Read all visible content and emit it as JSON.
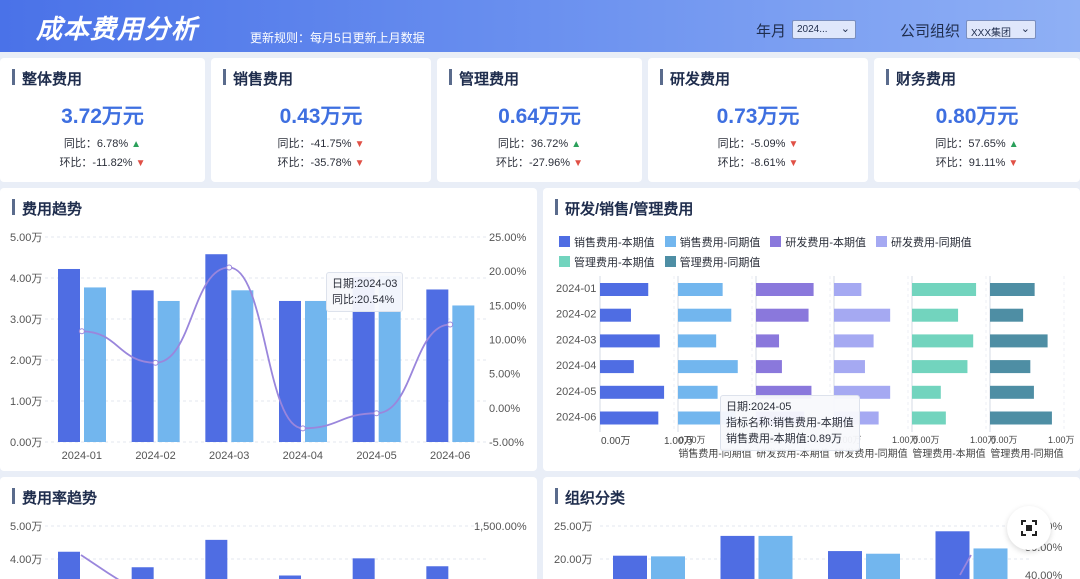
{
  "header": {
    "title": "成本费用分析",
    "rule": "更新规则：每月5日更新上月数据",
    "filter_year_label": "年月",
    "filter_year_value": "2024...",
    "filter_org_label": "公司组织",
    "filter_org_value": "XXX集团",
    "chevron_icon": "chevron-down-icon"
  },
  "kpis": [
    {
      "title": "整体费用",
      "value": "3.72万元",
      "yoy": "同比：6.78%",
      "yoy_dir": "up",
      "mom": "环比：-11.82%",
      "mom_dir": "down"
    },
    {
      "title": "销售费用",
      "value": "0.43万元",
      "yoy": "同比：-41.75%",
      "yoy_dir": "down",
      "mom": "环比：-35.78%",
      "mom_dir": "down"
    },
    {
      "title": "管理费用",
      "value": "0.64万元",
      "yoy": "同比：36.72%",
      "yoy_dir": "up",
      "mom": "环比：-27.96%",
      "mom_dir": "down"
    },
    {
      "title": "研发费用",
      "value": "0.73万元",
      "yoy": "同比：-5.09%",
      "yoy_dir": "down",
      "mom": "环比：-8.61%",
      "mom_dir": "down"
    },
    {
      "title": "财务费用",
      "value": "0.80万元",
      "yoy": "同比：57.65%",
      "yoy_dir": "up",
      "mom": "环比：91.11%",
      "mom_dir": "down"
    }
  ],
  "panels": {
    "trend_title": "费用趋势",
    "rd_title": "研发/销售/管理费用",
    "rate_title": "费用率趋势",
    "org_title": "组织分类"
  },
  "colors": {
    "dark_blue": "#4f6de3",
    "light_blue": "#72b6ee",
    "purple": "#8a78dc",
    "lavender": "#a5a9f2",
    "teal": "#72d4be",
    "slate": "#4e8ea4",
    "line": "#9a86dc",
    "up": "#2aa05a",
    "down": "#e05046"
  },
  "chart_data": [
    {
      "type": "bar",
      "title": "费用趋势",
      "categories": [
        "2024-01",
        "2024-02",
        "2024-03",
        "2024-04",
        "2024-05",
        "2024-06"
      ],
      "y_ticks": [
        "5.00万",
        "4.00万",
        "3.00万",
        "2.00万",
        "1.00万",
        "0.00万"
      ],
      "y2_ticks": [
        "25.00%",
        "20.00%",
        "15.00%",
        "10.00%",
        "5.00%",
        "0.00%",
        "-5.00%"
      ],
      "ylim": [
        0,
        5
      ],
      "y2lim": [
        -5,
        25
      ],
      "series": [
        {
          "values": [
            4.22,
            3.7,
            4.58,
            3.44,
            4.02,
            3.72
          ],
          "kind": "bar"
        },
        {
          "values": [
            3.77,
            3.44,
            3.7,
            3.44,
            4.05,
            3.33
          ],
          "kind": "bar"
        },
        {
          "values": [
            11.2,
            6.6,
            20.54,
            -3.0,
            -0.8,
            12.2
          ],
          "kind": "line",
          "axis": "right"
        }
      ],
      "tooltip": {
        "category": "2024-03",
        "line1": "日期:2024-03",
        "line2": "同比:20.54%"
      }
    },
    {
      "type": "bar",
      "title": "研发/销售/管理费用",
      "orientation": "horizontal",
      "categories": [
        "2024-01",
        "2024-02",
        "2024-03",
        "2024-04",
        "2024-05",
        "2024-06"
      ],
      "xlim": [
        0,
        1
      ],
      "x_ticks": [
        "0.00万",
        "1.00万"
      ],
      "series": [
        {
          "name": "销售费用-本期值",
          "values": [
            0.67,
            0.43,
            0.83,
            0.47,
            0.89,
            0.81
          ]
        },
        {
          "name": "销售费用-同期值",
          "values": [
            0.62,
            0.74,
            0.53,
            0.83,
            0.55,
            0.8
          ]
        },
        {
          "name": "研发费用-本期值",
          "values": [
            0.8,
            0.73,
            0.32,
            0.36,
            0.77,
            0.67
          ]
        },
        {
          "name": "研发费用-同期值",
          "values": [
            0.38,
            0.78,
            0.55,
            0.43,
            0.78,
            0.62
          ]
        },
        {
          "name": "管理费用-本期值",
          "values": [
            0.89,
            0.64,
            0.85,
            0.77,
            0.4,
            0.47
          ]
        },
        {
          "name": "管理费用-同期值",
          "values": [
            0.62,
            0.46,
            0.8,
            0.56,
            0.61,
            0.86
          ]
        }
      ],
      "tooltip": {
        "line1": "日期:2024-05",
        "line2": "指标名称:销售费用-本期值",
        "line3": "销售费用-本期值:0.89万"
      }
    },
    {
      "type": "bar",
      "title": "费用率趋势",
      "y_ticks": [
        "5.00万",
        "4.00万"
      ],
      "y2_ticks": [
        "1,500.00%"
      ],
      "ylim": [
        3.5,
        5.0
      ],
      "series": [
        {
          "values": [
            4.22,
            3.75,
            4.58,
            3.5,
            4.02,
            3.78
          ],
          "kind": "bar"
        }
      ]
    },
    {
      "type": "bar",
      "title": "组织分类",
      "y_ticks": [
        "25.00万",
        "20.00万"
      ],
      "y2_ticks": [
        "60.00%",
        "50.00%",
        "40.00%"
      ],
      "ylim": [
        15,
        27
      ],
      "series": [
        {
          "values": [
            20.5,
            23.5,
            21.2,
            24.2
          ],
          "kind": "bar"
        },
        {
          "values": [
            20.4,
            23.5,
            20.8,
            21.6
          ],
          "kind": "bar"
        }
      ]
    }
  ],
  "fab_icon": "focus-icon"
}
